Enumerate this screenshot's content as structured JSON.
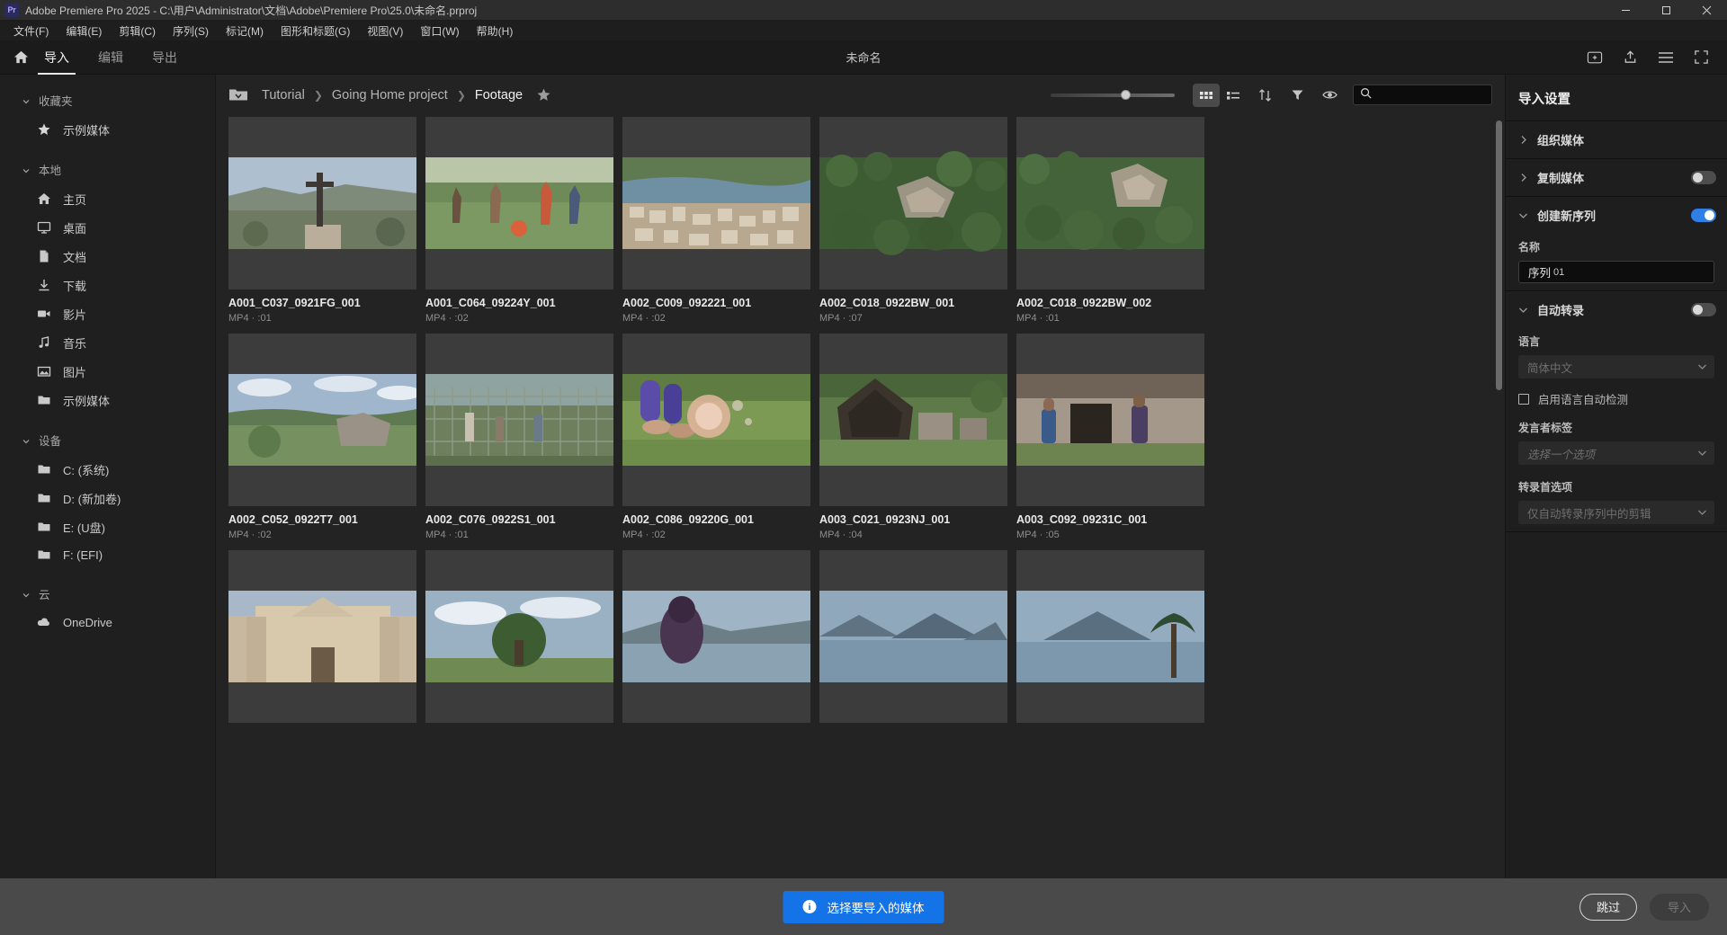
{
  "window": {
    "title": "Adobe Premiere Pro 2025 - C:\\用户\\Administrator\\文档\\Adobe\\Premiere Pro\\25.0\\未命名.prproj",
    "logo": "Pr",
    "minimize": "minimize-icon",
    "maximize": "maximize-icon",
    "close": "close-icon"
  },
  "menubar": {
    "items": [
      {
        "label": "文件(F)"
      },
      {
        "label": "编辑(E)"
      },
      {
        "label": "剪辑(C)"
      },
      {
        "label": "序列(S)"
      },
      {
        "label": "标记(M)"
      },
      {
        "label": "图形和标题(G)"
      },
      {
        "label": "视图(V)"
      },
      {
        "label": "窗口(W)"
      },
      {
        "label": "帮助(H)"
      }
    ]
  },
  "modebar": {
    "home_icon": "home-icon",
    "tabs": [
      {
        "label": "导入",
        "active": true
      },
      {
        "label": "编辑",
        "active": false
      },
      {
        "label": "导出",
        "active": false
      }
    ],
    "project_title": "未命名",
    "right_icons": [
      {
        "name": "new-project-icon"
      },
      {
        "name": "share-icon"
      },
      {
        "name": "menu-icon"
      },
      {
        "name": "fullscreen-icon"
      }
    ]
  },
  "sidebar": {
    "groups": [
      {
        "title": "收藏夹",
        "expanded": true,
        "items": [
          {
            "label": "示例媒体",
            "icon": "star-icon"
          }
        ]
      },
      {
        "title": "本地",
        "expanded": true,
        "items": [
          {
            "label": "主页",
            "icon": "home-icon"
          },
          {
            "label": "桌面",
            "icon": "monitor-icon"
          },
          {
            "label": "文档",
            "icon": "document-icon"
          },
          {
            "label": "下载",
            "icon": "download-icon"
          },
          {
            "label": "影片",
            "icon": "video-camera-icon"
          },
          {
            "label": "音乐",
            "icon": "music-note-icon"
          },
          {
            "label": "图片",
            "icon": "image-icon"
          },
          {
            "label": "示例媒体",
            "icon": "folder-icon"
          }
        ]
      },
      {
        "title": "设备",
        "expanded": true,
        "items": [
          {
            "label": "C: (系统)",
            "icon": "folder-icon"
          },
          {
            "label": "D: (新加卷)",
            "icon": "folder-icon"
          },
          {
            "label": "E: (U盘)",
            "icon": "folder-icon"
          },
          {
            "label": "F: (EFI)",
            "icon": "folder-icon"
          }
        ]
      },
      {
        "title": "云",
        "expanded": true,
        "items": [
          {
            "label": "OneDrive",
            "icon": "cloud-icon"
          }
        ]
      }
    ]
  },
  "toolbar": {
    "folder_icon": "folder-dropdown-icon",
    "breadcrumb": [
      {
        "label": "Tutorial",
        "current": false
      },
      {
        "label": "Going Home project",
        "current": false
      },
      {
        "label": "Footage",
        "current": true
      }
    ],
    "favorite_icon": "star-icon",
    "zoom_value": 57,
    "grid_view_icon": "grid-view-icon",
    "list_view_icon": "list-view-icon",
    "sort_icon": "sort-icon",
    "filter_icon": "filter-icon",
    "preview_icon": "eye-icon",
    "search_icon": "search-icon",
    "search_value": "",
    "search_placeholder": ""
  },
  "media": {
    "items": [
      {
        "name": "A001_C037_0921FG_001",
        "meta": "MP4 · :01",
        "scene": "cross-monument-city"
      },
      {
        "name": "A001_C064_09224Y_001",
        "meta": "MP4 · :02",
        "scene": "soccer-players-field"
      },
      {
        "name": "A002_C009_092221_001",
        "meta": "MP4 · :02",
        "scene": "aerial-lakeside-town"
      },
      {
        "name": "A002_C018_0922BW_001",
        "meta": "MP4 · :07",
        "scene": "aerial-jungle-ruins"
      },
      {
        "name": "A002_C018_0922BW_002",
        "meta": "MP4 · :01",
        "scene": "aerial-temple-canopy"
      },
      {
        "name": "A002_C052_0922T7_001",
        "meta": "MP4 · :02",
        "scene": "hilltop-vista-clouds"
      },
      {
        "name": "A002_C076_0922S1_001",
        "meta": "MP4 · :01",
        "scene": "fence-children-play"
      },
      {
        "name": "A002_C086_09220G_001",
        "meta": "MP4 · :02",
        "scene": "feet-water-splash-grass"
      },
      {
        "name": "A003_C021_0923NJ_001",
        "meta": "MP4 · :04",
        "scene": "thatched-hut-ruins"
      },
      {
        "name": "A003_C092_09231C_001",
        "meta": "MP4 · :05",
        "scene": "children-doorway-hut"
      },
      {
        "name": "",
        "meta": "",
        "scene": "colonial-church-facade"
      },
      {
        "name": "",
        "meta": "",
        "scene": "lone-tree-cloudscape"
      },
      {
        "name": "",
        "meta": "",
        "scene": "woman-looking-at-lake"
      },
      {
        "name": "",
        "meta": "",
        "scene": "volcano-lake-dusk"
      },
      {
        "name": "",
        "meta": "",
        "scene": "palm-lake-volcano"
      }
    ]
  },
  "settings": {
    "title": "导入设置",
    "sections": [
      {
        "label": "组织媒体",
        "expanded": false,
        "has_toggle": false
      },
      {
        "label": "复制媒体",
        "expanded": false,
        "has_toggle": true,
        "toggle_on": false
      },
      {
        "label": "创建新序列",
        "expanded": true,
        "has_toggle": true,
        "toggle_on": true
      },
      {
        "label": "自动转录",
        "expanded": true,
        "has_toggle": true,
        "toggle_on": false
      }
    ],
    "sequence": {
      "name_label": "名称",
      "name_value": "序列",
      "name_number": "01"
    },
    "transcription": {
      "language_label": "语言",
      "language_value": "简体中文",
      "autodetect_label": "启用语言自动检测",
      "autodetect_checked": false,
      "speaker_label": "发言者标签",
      "speaker_placeholder": "选择一个选项",
      "pref_label": "转录首选项",
      "pref_value": "仅自动转录序列中的剪辑"
    }
  },
  "bottombar": {
    "hint_icon": "info-icon",
    "hint_label": "选择要导入的媒体",
    "skip_label": "跳过",
    "import_label": "导入"
  },
  "colors": {
    "accent_blue": "#1473e6",
    "toggle_on": "#2f7fe8",
    "panel_bg": "#1e1e1e",
    "main_bg": "#232323",
    "bottom_bar": "#4a4a4a"
  }
}
